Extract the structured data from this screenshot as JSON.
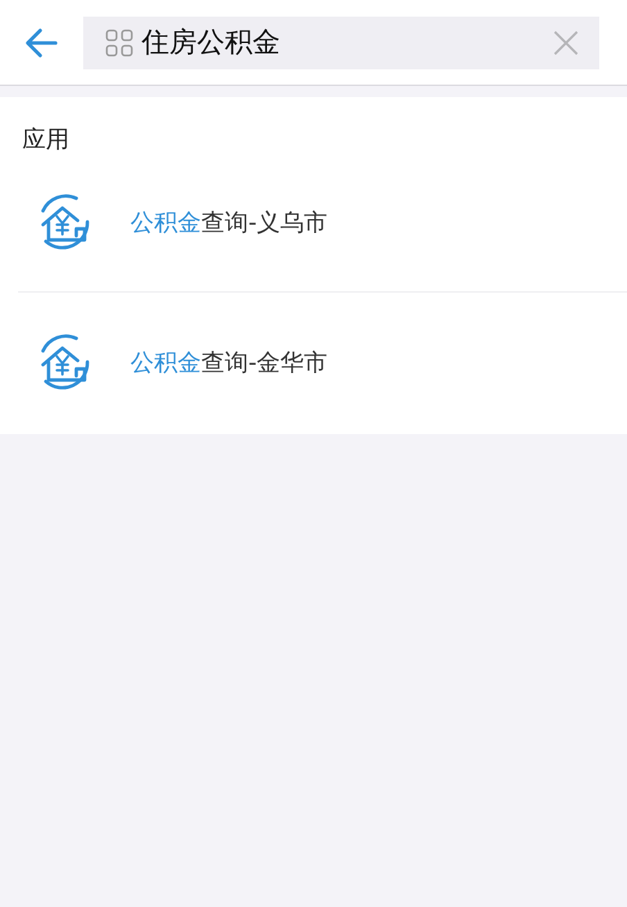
{
  "search": {
    "value": "住房公积金"
  },
  "section": {
    "title": "应用",
    "results": [
      {
        "title": "**公积金**查询-义乌市"
      },
      {
        "title": "**公积金**查询-金华市"
      }
    ]
  }
}
